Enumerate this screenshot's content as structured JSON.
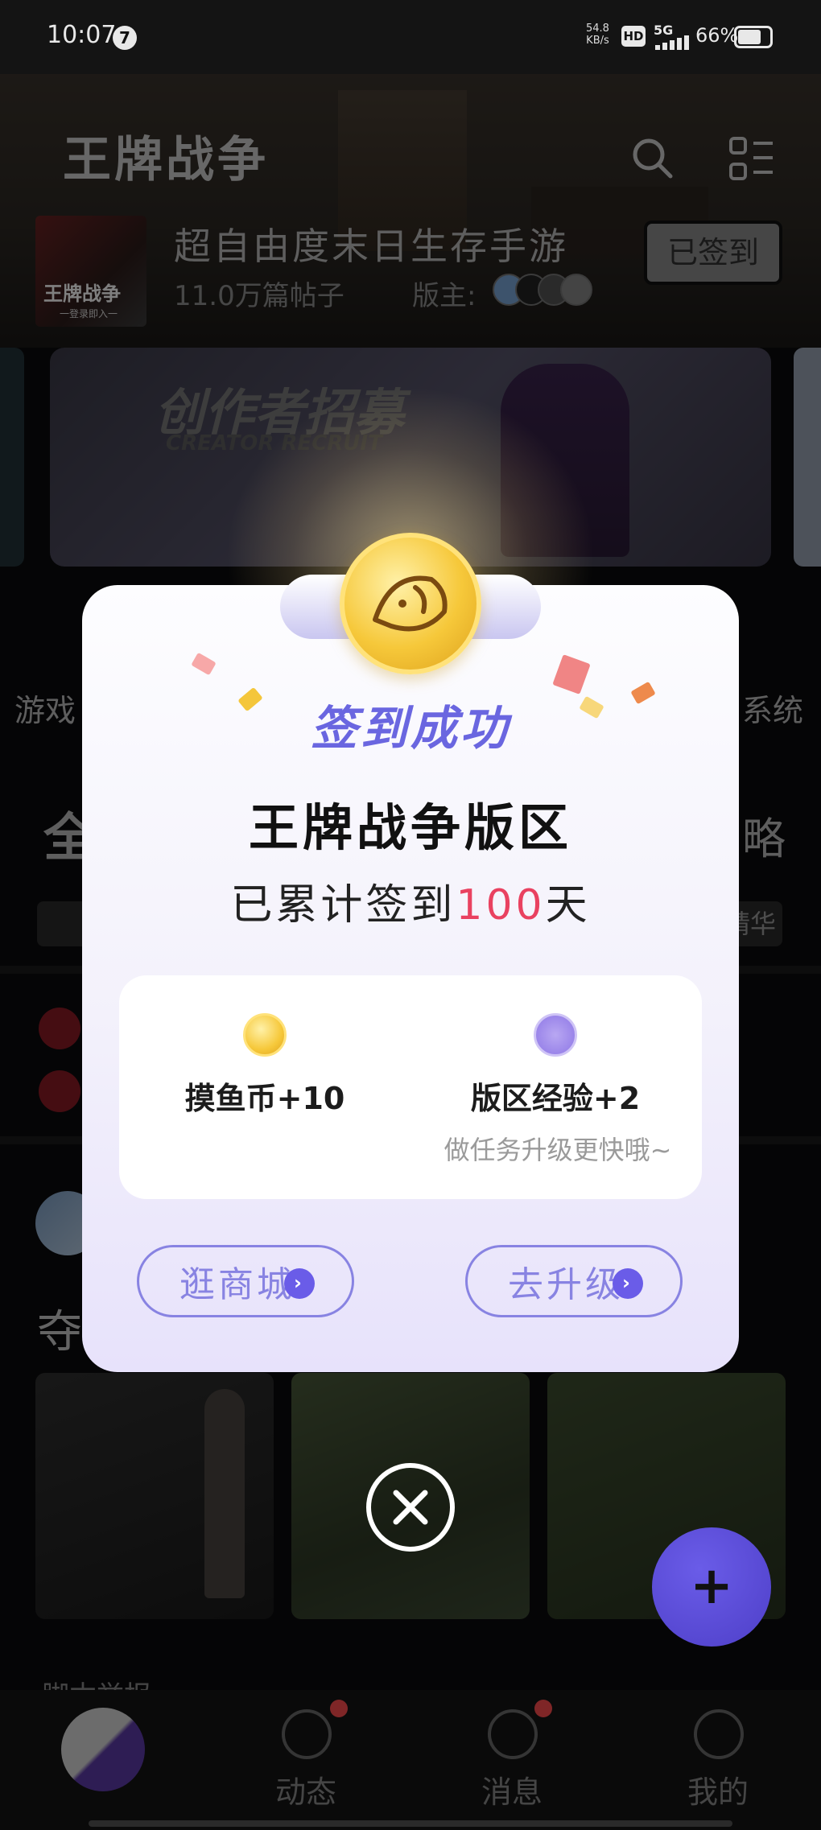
{
  "status_bar": {
    "time": "10:07",
    "notification_count": "7",
    "net_speed": "54.8",
    "net_unit": "KB/s",
    "hd": "HD",
    "signal": "5G",
    "battery": "66%"
  },
  "header": {
    "title": "王牌战争",
    "search_icon": "search-icon",
    "menu_icon": "grid-menu-icon"
  },
  "forum": {
    "thumb_title": "王牌战争",
    "thumb_subtitle": "一登录即入一",
    "slogan": "超自由度末日生存手游",
    "posts": "11.0万篇帖子",
    "moderators_label": "版主:",
    "signed_label": "已签到"
  },
  "banner": {
    "title": "创作者招募",
    "subtitle": "CREATOR RECRUIT"
  },
  "categories": {
    "left_label": "游戏",
    "right_label": "系统"
  },
  "tabs": {
    "left_label": "全",
    "right_label": "略",
    "chip_right": "精华"
  },
  "post": {
    "title_partial": "夺",
    "footer_partial": "脚本举报"
  },
  "bottom_nav": {
    "items": [
      {
        "label": "动态",
        "icon": "compass-icon"
      },
      {
        "label": "消息",
        "icon": "chat-icon"
      },
      {
        "label": "我的",
        "icon": "person-icon"
      }
    ]
  },
  "modal": {
    "success_title": "签到成功",
    "board_name": "王牌战争版区",
    "streak_prefix": "已累计签到",
    "streak_days": "100",
    "streak_suffix": "天",
    "rewards": [
      {
        "label": "摸鱼币+10",
        "icon": "fish-coin-icon"
      },
      {
        "label": "版区经验+2",
        "icon": "star-badge-icon",
        "note": "做任务升级更快哦~"
      }
    ],
    "buttons": {
      "shop": "逛商城",
      "upgrade": "去升级"
    },
    "colors": {
      "accent": "#6a66e0",
      "streak_number": "#e94160",
      "coin": "#f6c83a"
    }
  },
  "fab_label": "+"
}
